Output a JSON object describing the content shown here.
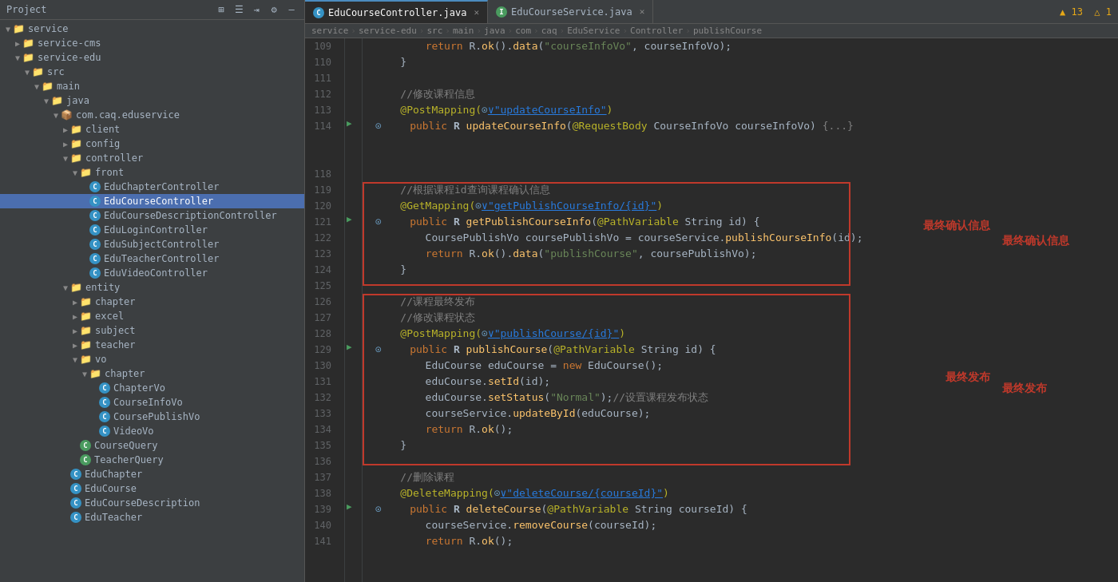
{
  "sidebar": {
    "toolbar_title": "Project",
    "tree": [
      {
        "id": "service",
        "label": "service",
        "level": 0,
        "type": "folder-open",
        "expanded": true
      },
      {
        "id": "service-cms",
        "label": "service-cms",
        "level": 1,
        "type": "folder",
        "expanded": false
      },
      {
        "id": "service-edu",
        "label": "service-edu",
        "level": 1,
        "type": "folder-open",
        "expanded": true
      },
      {
        "id": "src",
        "label": "src",
        "level": 2,
        "type": "folder-open",
        "expanded": true
      },
      {
        "id": "main",
        "label": "main",
        "level": 3,
        "type": "folder-open",
        "expanded": true
      },
      {
        "id": "java",
        "label": "java",
        "level": 4,
        "type": "folder-open",
        "expanded": true
      },
      {
        "id": "com.caq.eduservice",
        "label": "com.caq.eduservice",
        "level": 5,
        "type": "folder-open",
        "expanded": true
      },
      {
        "id": "client",
        "label": "client",
        "level": 6,
        "type": "folder",
        "expanded": false
      },
      {
        "id": "config",
        "label": "config",
        "level": 6,
        "type": "folder",
        "expanded": false
      },
      {
        "id": "controller",
        "label": "controller",
        "level": 6,
        "type": "folder-open",
        "expanded": true
      },
      {
        "id": "front",
        "label": "front",
        "level": 7,
        "type": "folder-open",
        "expanded": true
      },
      {
        "id": "EduChapterController",
        "label": "EduChapterController",
        "level": 8,
        "type": "java-c"
      },
      {
        "id": "EduCourseController",
        "label": "EduCourseController",
        "level": 8,
        "type": "java-c",
        "selected": true
      },
      {
        "id": "EduCourseDescriptionController",
        "label": "EduCourseDescriptionController",
        "level": 8,
        "type": "java-c"
      },
      {
        "id": "EduLoginController",
        "label": "EduLoginController",
        "level": 8,
        "type": "java-c"
      },
      {
        "id": "EduSubjectController",
        "label": "EduSubjectController",
        "level": 8,
        "type": "java-c"
      },
      {
        "id": "EduTeacherController",
        "label": "EduTeacherController",
        "level": 8,
        "type": "java-c"
      },
      {
        "id": "EduVideoController",
        "label": "EduVideoController",
        "level": 8,
        "type": "java-c"
      },
      {
        "id": "entity",
        "label": "entity",
        "level": 6,
        "type": "folder-open",
        "expanded": true
      },
      {
        "id": "chapter",
        "label": "chapter",
        "level": 7,
        "type": "folder",
        "expanded": false
      },
      {
        "id": "excel",
        "label": "excel",
        "level": 7,
        "type": "folder",
        "expanded": false
      },
      {
        "id": "subject",
        "label": "subject",
        "level": 7,
        "type": "folder",
        "expanded": false
      },
      {
        "id": "teacher",
        "label": "teacher",
        "level": 7,
        "type": "folder",
        "expanded": false
      },
      {
        "id": "vo",
        "label": "vo",
        "level": 7,
        "type": "folder-open",
        "expanded": true
      },
      {
        "id": "chapter2",
        "label": "chapter",
        "level": 8,
        "type": "folder-open",
        "expanded": true
      },
      {
        "id": "ChapterVo",
        "label": "ChapterVo",
        "level": 9,
        "type": "java-c"
      },
      {
        "id": "CourseInfoVo",
        "label": "CourseInfoVo",
        "level": 9,
        "type": "java-c"
      },
      {
        "id": "CoursePublishVo",
        "label": "CoursePublishVo",
        "level": 9,
        "type": "java-c"
      },
      {
        "id": "VideoVo",
        "label": "VideoVo",
        "level": 9,
        "type": "java-c"
      },
      {
        "id": "CourseQuery",
        "label": "CourseQuery",
        "level": 7,
        "type": "java-green"
      },
      {
        "id": "TeacherQuery",
        "label": "TeacherQuery",
        "level": 7,
        "type": "java-green"
      },
      {
        "id": "EduChapter",
        "label": "EduChapter",
        "level": 6,
        "type": "java-c"
      },
      {
        "id": "EduCourse",
        "label": "EduCourse",
        "level": 6,
        "type": "java-c"
      },
      {
        "id": "EduCourseDescription",
        "label": "EduCourseDescription",
        "level": 6,
        "type": "java-c"
      },
      {
        "id": "EduTeacher",
        "label": "EduTeacher",
        "level": 6,
        "type": "java-c"
      }
    ]
  },
  "tabs": [
    {
      "id": "EduCourseController",
      "label": "EduCourseController.java",
      "active": true,
      "icon": "java-c"
    },
    {
      "id": "EduCourseService",
      "label": "EduCourseService.java",
      "active": false,
      "icon": "java-green"
    }
  ],
  "breadcrumb": [
    "service",
    "service-edu",
    "src",
    "main",
    "java",
    "com",
    "caq",
    "EduService",
    "Controller",
    "publishCourse"
  ],
  "warning": "▲ 13  △ 1",
  "code_lines": [
    {
      "num": 109,
      "content": "        return R.ok().data(\"courseInfoVo\", courseInfoVo);",
      "marker": ""
    },
    {
      "num": 110,
      "content": "    }",
      "marker": ""
    },
    {
      "num": 111,
      "content": "",
      "marker": ""
    },
    {
      "num": 112,
      "content": "    //修改课程信息",
      "marker": "",
      "class": "cmt"
    },
    {
      "num": 113,
      "content": "@PostMapping(⊙∨\"updateCourseInfo\")",
      "marker": "",
      "class": "ann"
    },
    {
      "num": 114,
      "content": "    public R updateCourseInfo(@RequestBody CourseInfoVo courseInfoVo) {...}",
      "marker": "⊙",
      "class": "mixed"
    },
    {
      "num": 118,
      "content": "",
      "marker": ""
    },
    {
      "num": 119,
      "content": "    //根据课程id查询课程确认信息",
      "marker": "",
      "class": "cmt"
    },
    {
      "num": 120,
      "content": "@GetMapping(⊙∨\"getPublishCourseInfo/{id}\")",
      "marker": "",
      "class": "ann"
    },
    {
      "num": 121,
      "content": "    public R getPublishCourseInfo(@PathVariable String id) {",
      "marker": "⊙",
      "class": "mixed"
    },
    {
      "num": 122,
      "content": "        CoursePublishVo coursePublishVo = courseService.publishCourseInfo(id);",
      "marker": ""
    },
    {
      "num": 123,
      "content": "        return R.ok().data(\"publishCourse\", coursePublishVo);",
      "marker": ""
    },
    {
      "num": 124,
      "content": "    }",
      "marker": ""
    },
    {
      "num": 125,
      "content": "",
      "marker": ""
    },
    {
      "num": 126,
      "content": "    //课程最终发布",
      "marker": "",
      "class": "cmt"
    },
    {
      "num": 127,
      "content": "    //修改课程状态",
      "marker": "",
      "class": "cmt"
    },
    {
      "num": 128,
      "content": "@PostMapping(⊙∨\"publishCourse/{id}\")",
      "marker": "",
      "class": "ann"
    },
    {
      "num": 129,
      "content": "    public R publishCourse(@PathVariable String id) {",
      "marker": "⊙",
      "class": "mixed"
    },
    {
      "num": 130,
      "content": "        EduCourse eduCourse = new EduCourse();",
      "marker": ""
    },
    {
      "num": 131,
      "content": "        eduCourse.setId(id);",
      "marker": ""
    },
    {
      "num": 132,
      "content": "        eduCourse.setStatus(\"Normal\");//设置课程发布状态",
      "marker": ""
    },
    {
      "num": 133,
      "content": "        courseService.updateById(eduCourse);",
      "marker": ""
    },
    {
      "num": 134,
      "content": "        return R.ok();",
      "marker": ""
    },
    {
      "num": 135,
      "content": "    }",
      "marker": ""
    },
    {
      "num": 136,
      "content": "",
      "marker": ""
    },
    {
      "num": 137,
      "content": "    //删除课程",
      "marker": "",
      "class": "cmt"
    },
    {
      "num": 138,
      "content": "@DeleteMapping(⊙∨\"deleteCourse/{courseId}\")",
      "marker": "",
      "class": "ann"
    },
    {
      "num": 139,
      "content": "    public R deleteCourse(@PathVariable String courseId) {",
      "marker": "⊙",
      "class": "mixed"
    },
    {
      "num": 140,
      "content": "        courseService.removeCourse(courseId);",
      "marker": ""
    },
    {
      "num": 141,
      "content": "        return R.ok();",
      "marker": ""
    }
  ],
  "annotations": {
    "box1_label": "最终确认信息",
    "box2_label": "最终发布"
  }
}
